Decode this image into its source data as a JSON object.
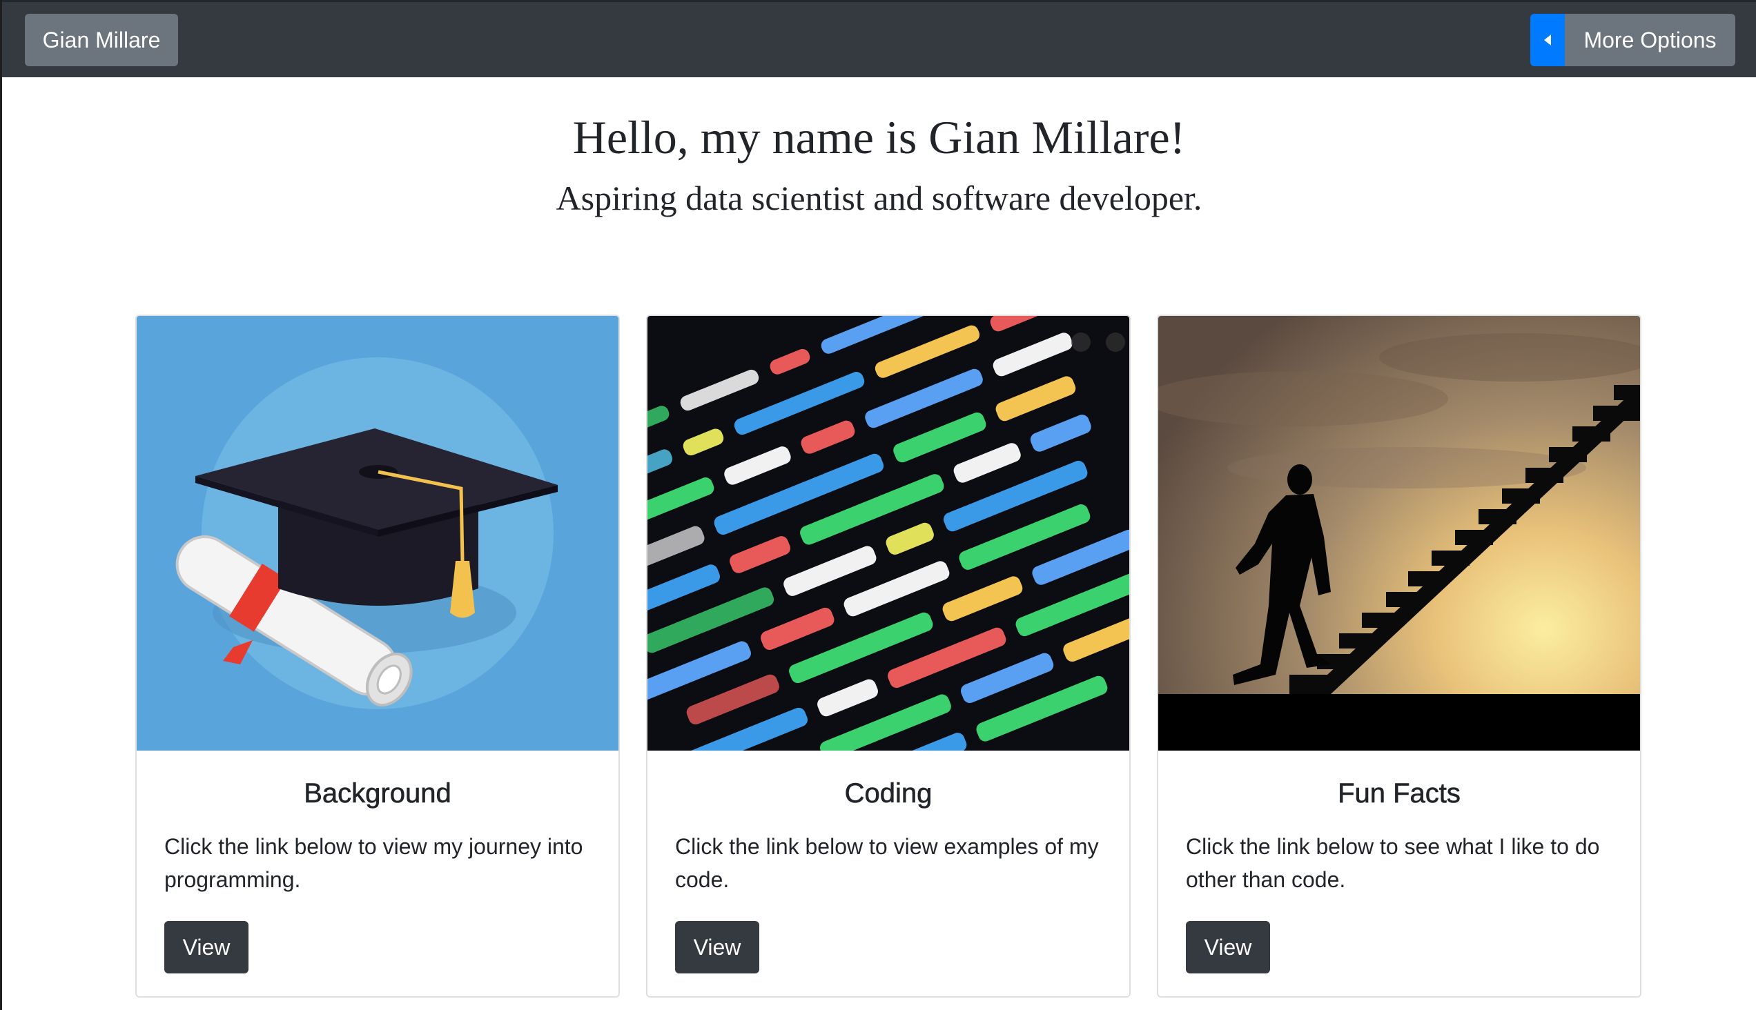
{
  "navbar": {
    "brand_label": "Gian Millare",
    "options_label": "More Options",
    "caret_icon": "caret-left-icon",
    "colors": {
      "bar": "#343a40",
      "secondary": "#6c757d",
      "primary": "#007bff"
    }
  },
  "hero": {
    "title": "Hello, my name is Gian Millare!",
    "subtitle": "Aspiring data scientist and software developer."
  },
  "cards": [
    {
      "image_icon": "graduation-cap-icon",
      "title": "Background",
      "text": "Click the link below to view my journey into programming.",
      "button_label": "View"
    },
    {
      "image_icon": "code-screen-icon",
      "title": "Coding",
      "text": "Click the link below to view examples of my code.",
      "button_label": "View"
    },
    {
      "image_icon": "staircase-silhouette-icon",
      "title": "Fun Facts",
      "text": "Click the link below to see what I like to do other than code.",
      "button_label": "View"
    }
  ]
}
